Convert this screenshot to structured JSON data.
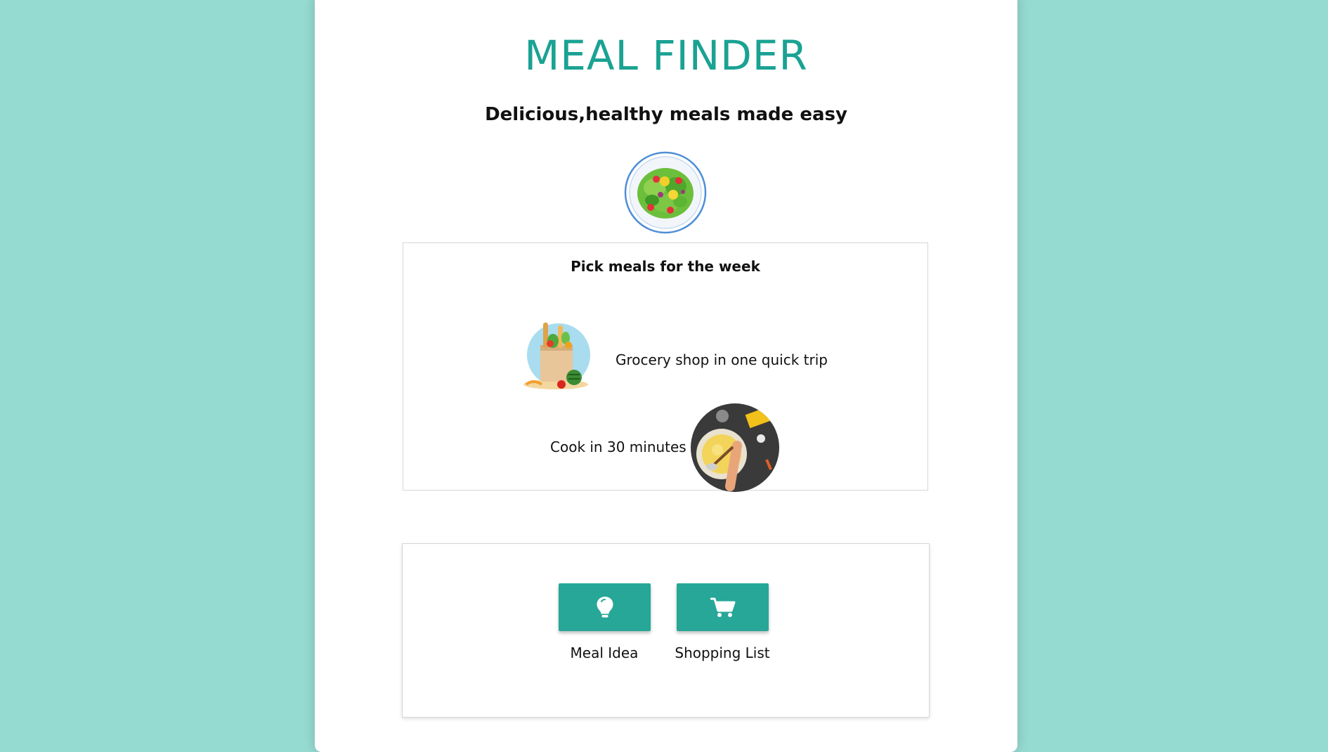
{
  "header": {
    "title": "MEAL FINDER",
    "subtitle": "Delicious,healthy meals made easy"
  },
  "plan_card": {
    "title": "Pick meals for the week",
    "features": [
      {
        "text": "Grocery shop in one quick trip",
        "icon": "grocery-bag-icon"
      },
      {
        "text": "Cook in 30 minutes",
        "icon": "cooking-pot-icon"
      }
    ]
  },
  "actions": {
    "buttons": [
      {
        "label": "Meal Idea",
        "icon": "lightbulb-icon"
      },
      {
        "label": "Shopping List",
        "icon": "cart-icon"
      }
    ]
  },
  "colors": {
    "background": "#96dbd2",
    "accent": "#1aa293",
    "button": "#26a797"
  }
}
